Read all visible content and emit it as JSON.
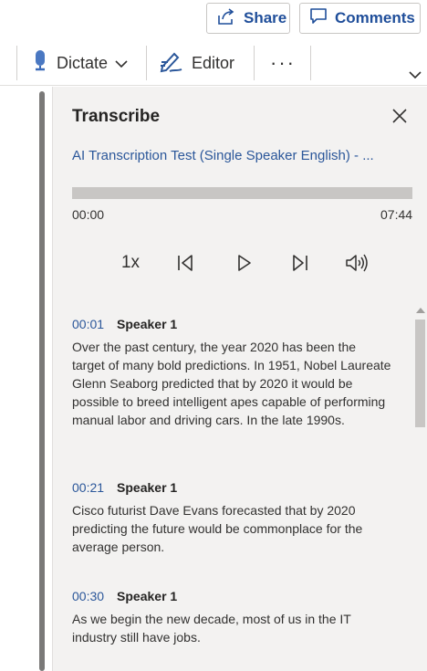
{
  "top_actions": {
    "share_label": "Share",
    "comments_label": "Comments"
  },
  "ribbon": {
    "dictate_label": "Dictate",
    "editor_label": "Editor",
    "more_label": "···"
  },
  "pane": {
    "title": "Transcribe",
    "file_title": "AI Transcription Test (Single Speaker English) - ...",
    "progress": 0,
    "time_start": "00:00",
    "time_end": "07:44",
    "speed_label": "1x"
  },
  "transcript": [
    {
      "time": "00:01",
      "speaker": "Speaker 1",
      "text": "Over the past century, the year 2020 has been the target of many bold predictions. In 1951, Nobel Laureate Glenn Seaborg predicted that by 2020 it would be possible to breed intelligent apes capable of performing manual labor and driving cars. In the late 1990s."
    },
    {
      "time": "00:21",
      "speaker": "Speaker 1",
      "text": "Cisco futurist Dave Evans forecasted that by 2020 predicting the future would be commonplace for the average person."
    },
    {
      "time": "00:30",
      "speaker": "Speaker 1",
      "text": "As we begin the new decade, most of us in the IT industry still have jobs."
    }
  ],
  "colors": {
    "accent": "#2b579a",
    "pane_bg": "#f3f2f1"
  }
}
